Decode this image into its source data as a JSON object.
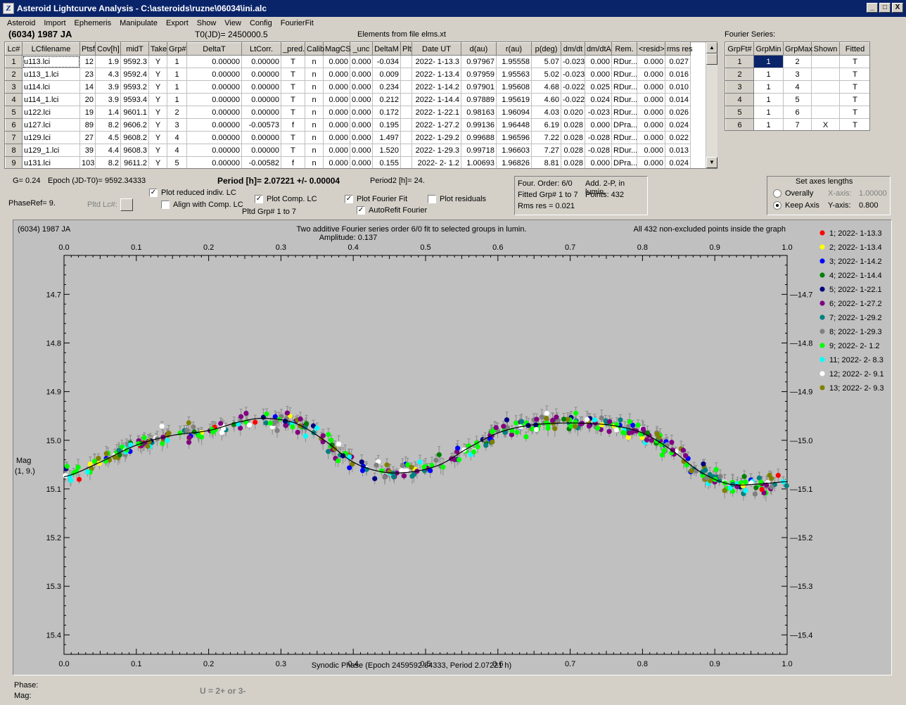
{
  "window": {
    "title": "Asteroid Lightcurve Analysis - C:\\asteroids\\ruzne\\06034\\ini.alc",
    "icon_letter": "Z",
    "buttons": [
      "_",
      "□",
      "X"
    ]
  },
  "menu": [
    "Asteroid",
    "Import",
    "Ephemeris",
    "Manipulate",
    "Export",
    "Show",
    "View",
    "Config",
    "FourierFit"
  ],
  "header": {
    "object": "(6034) 1987 JA",
    "t0": "T0(JD)= 2450000.5",
    "elements": "Elements from file elms.xt",
    "fourier_label": "Fourier Series:"
  },
  "lc_table": {
    "columns": [
      "Lc#",
      "LCfilename",
      "Ptsf",
      "Cov[h]",
      "midT",
      "Take",
      "Grp#",
      "DeltaT",
      "LtCorr.",
      "_pred.",
      "Calib",
      "MagCS",
      "_unc",
      "DeltaM",
      "Plt",
      "Date UT",
      "d(au)",
      "r(au)",
      "p(deg)",
      "dm/dt",
      "dm/dtA",
      "Rem.",
      "<resid>",
      "rms res"
    ],
    "rows": [
      [
        "1",
        "u113.lci",
        "12",
        "1.9",
        "9592.3",
        "Y",
        "1",
        "0.00000",
        "0.00000",
        "T",
        "n",
        "0.000",
        "0.000",
        "-0.034",
        "",
        "2022- 1-13.3",
        "0.97967",
        "1.95558",
        "5.07",
        "-0.023",
        "0.000",
        "RDur...",
        "0.000",
        "0.027"
      ],
      [
        "2",
        "u113_1.lci",
        "23",
        "4.3",
        "9592.4",
        "Y",
        "1",
        "0.00000",
        "0.00000",
        "T",
        "n",
        "0.000",
        "0.000",
        "0.009",
        "",
        "2022- 1-13.4",
        "0.97959",
        "1.95563",
        "5.02",
        "-0.023",
        "0.000",
        "RDur...",
        "0.000",
        "0.016"
      ],
      [
        "3",
        "u114.lci",
        "14",
        "3.9",
        "9593.2",
        "Y",
        "1",
        "0.00000",
        "0.00000",
        "T",
        "n",
        "0.000",
        "0.000",
        "0.234",
        "",
        "2022- 1-14.2",
        "0.97901",
        "1.95608",
        "4.68",
        "-0.022",
        "0.025",
        "RDur...",
        "0.000",
        "0.010"
      ],
      [
        "4",
        "u114_1.lci",
        "20",
        "3.9",
        "9593.4",
        "Y",
        "1",
        "0.00000",
        "0.00000",
        "T",
        "n",
        "0.000",
        "0.000",
        "0.212",
        "",
        "2022- 1-14.4",
        "0.97889",
        "1.95619",
        "4.60",
        "-0.022",
        "0.024",
        "RDur...",
        "0.000",
        "0.014"
      ],
      [
        "5",
        "u122.lci",
        "19",
        "1.4",
        "9601.1",
        "Y",
        "2",
        "0.00000",
        "0.00000",
        "T",
        "n",
        "0.000",
        "0.000",
        "0.172",
        "",
        "2022- 1-22.1",
        "0.98163",
        "1.96094",
        "4.03",
        "0.020",
        "-0.023",
        "RDur...",
        "0.000",
        "0.026"
      ],
      [
        "6",
        "u127.lci",
        "89",
        "8.2",
        "9606.2",
        "Y",
        "3",
        "0.00000",
        "-0.00573",
        "f",
        "n",
        "0.000",
        "0.000",
        "0.195",
        "",
        "2022- 1-27.2",
        "0.99136",
        "1.96448",
        "6.19",
        "0.028",
        "0.000",
        "DPra...",
        "0.000",
        "0.024"
      ],
      [
        "7",
        "u129.lci",
        "27",
        "4.5",
        "9608.2",
        "Y",
        "4",
        "0.00000",
        "0.00000",
        "T",
        "n",
        "0.000",
        "0.000",
        "1.497",
        "",
        "2022- 1-29.2",
        "0.99688",
        "1.96596",
        "7.22",
        "0.028",
        "-0.028",
        "RDur...",
        "0.000",
        "0.022"
      ],
      [
        "8",
        "u129_1.lci",
        "39",
        "4.4",
        "9608.3",
        "Y",
        "4",
        "0.00000",
        "0.00000",
        "T",
        "n",
        "0.000",
        "0.000",
        "1.520",
        "",
        "2022- 1-29.3",
        "0.99718",
        "1.96603",
        "7.27",
        "0.028",
        "-0.028",
        "RDur...",
        "0.000",
        "0.013"
      ],
      [
        "9",
        "u131.lci",
        "103",
        "8.2",
        "9611.2",
        "Y",
        "5",
        "0.00000",
        "-0.00582",
        "f",
        "n",
        "0.000",
        "0.000",
        "0.155",
        "",
        "2022- 2- 1.2",
        "1.00693",
        "1.96826",
        "8.81",
        "0.028",
        "0.000",
        "DPra...",
        "0.000",
        "0.024"
      ]
    ]
  },
  "fourier_table": {
    "columns": [
      "GrpFt#",
      "GrpMin",
      "GrpMax",
      "Shown",
      "Fitted"
    ],
    "rows": [
      [
        "1",
        "1",
        "2",
        "",
        "T"
      ],
      [
        "2",
        "1",
        "3",
        "",
        "T"
      ],
      [
        "3",
        "1",
        "4",
        "",
        "T"
      ],
      [
        "4",
        "1",
        "5",
        "",
        "T"
      ],
      [
        "5",
        "1",
        "6",
        "",
        "T"
      ],
      [
        "6",
        "1",
        "7",
        "X",
        "T"
      ]
    ]
  },
  "controls": {
    "g": "G= 0.24",
    "epoch": "Epoch (JD-T0)= 9592.34333",
    "period": "Period [h]= 2.07221 +/- 0.00004",
    "period2": "Period2 [h]= 24.",
    "phase_ref": "PhaseRef= 9.",
    "pltd_lc": "Pltd Lc#:",
    "plot_reduced": "Plot reduced indiv. LC",
    "align_comp": "Align with Comp. LC",
    "plot_comp": "Plot Comp. LC",
    "pltd_grp": "Pltd Grp#  1   to   7",
    "plot_fourier": "Plot Fourier Fit",
    "autorefit": "AutoRefit Fourier",
    "plot_residuals": "Plot residuals",
    "checks": {
      "plot_reduced": true,
      "align_comp": false,
      "plot_comp": true,
      "plot_fourier": true,
      "autorefit": true,
      "plot_residuals": false
    }
  },
  "fit_info": {
    "order": "Four. Order:  6/0",
    "add": "Add. 2-P, in lumin.",
    "fitted": "Fitted Grp# 1 to 7",
    "points": "Points: 432",
    "rms": "Rms res      = 0.021"
  },
  "axes_box": {
    "title": "Set axes lengths",
    "overally": "Overally",
    "keep_axis": "Keep Axis",
    "x_axis": "X-axis:",
    "x_value": "1.00000",
    "y_axis": "Y-axis:",
    "y_value": "0.800",
    "selected": "keep_axis"
  },
  "chart_data": {
    "type": "scatter",
    "title_left": "(6034) 1987 JA",
    "title_center": "Two additive Fourier series order 6/0 fit to selected groups in lumin.",
    "subtitle": "Amplitude: 0.137",
    "title_right": "All 432 non-excluded points inside the graph",
    "xlabel": "Synodic Phase (Epoch 2459592.84333, Period 2.07221 h)",
    "ylabel": "Mag",
    "ylabel2": "(1, 9.)",
    "xlim": [
      0,
      1
    ],
    "ylim": [
      14.62,
      15.44
    ],
    "y_inverted": true,
    "x_ticks": [
      "0.0",
      "0.1",
      "0.2",
      "0.3",
      "0.4",
      "0.5",
      "0.6",
      "0.7",
      "0.8",
      "0.9",
      "1.0"
    ],
    "y_ticks": [
      "14.7",
      "14.8",
      "14.9",
      "15.0",
      "15.1",
      "15.2",
      "15.3",
      "15.4"
    ],
    "fit_curve": {
      "x": [
        0.0,
        0.05,
        0.1,
        0.15,
        0.2,
        0.25,
        0.28,
        0.32,
        0.36,
        0.4,
        0.44,
        0.48,
        0.52,
        0.56,
        0.6,
        0.64,
        0.68,
        0.72,
        0.76,
        0.8,
        0.84,
        0.88,
        0.92,
        0.96,
        1.0
      ],
      "y": [
        15.075,
        15.045,
        15.01,
        14.99,
        14.98,
        14.96,
        14.955,
        14.965,
        15.0,
        15.045,
        15.065,
        15.065,
        15.05,
        15.015,
        14.985,
        14.97,
        14.965,
        14.965,
        14.97,
        14.985,
        15.02,
        15.065,
        15.09,
        15.09,
        15.085
      ]
    },
    "point_count": 432,
    "series": [
      {
        "name": "1; 2022- 1-13.3",
        "color": "#ff0000"
      },
      {
        "name": "2; 2022- 1-13.4",
        "color": "#ffff00"
      },
      {
        "name": "3; 2022- 1-14.2",
        "color": "#0000ff"
      },
      {
        "name": "4; 2022- 1-14.4",
        "color": "#008000"
      },
      {
        "name": "5; 2022- 1-22.1",
        "color": "#000080"
      },
      {
        "name": "6; 2022- 1-27.2",
        "color": "#800080"
      },
      {
        "name": "7; 2022- 1-29.2",
        "color": "#008080"
      },
      {
        "name": "8; 2022- 1-29.3",
        "color": "#808080"
      },
      {
        "name": "9; 2022- 2- 1.2",
        "color": "#00ff00"
      },
      {
        "name": "11; 2022- 2- 8.3",
        "color": "#00ffff"
      },
      {
        "name": "12; 2022- 2- 9.1",
        "color": "#ffffff"
      },
      {
        "name": "13; 2022- 2- 9.3",
        "color": "#808000"
      }
    ]
  },
  "status": {
    "phase": "Phase:",
    "mag": "Mag:",
    "hint": "U = 2+ or 3-"
  }
}
